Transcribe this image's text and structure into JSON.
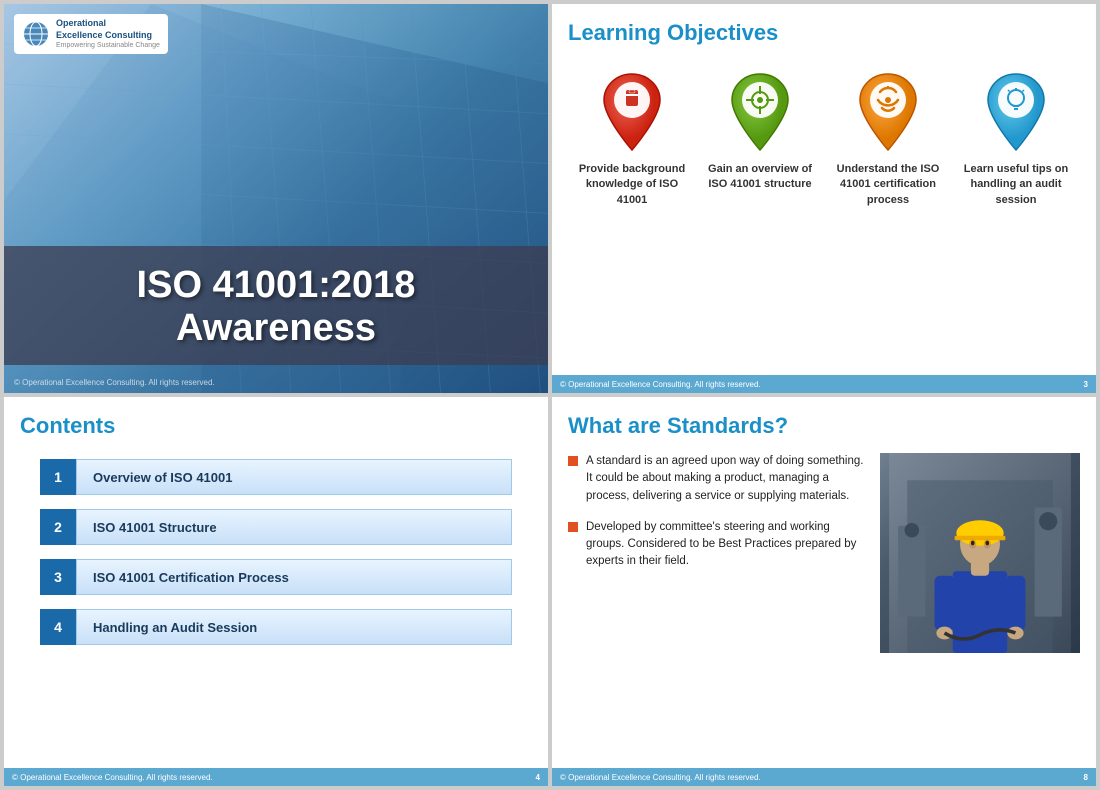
{
  "slide1": {
    "logo_name1": "Operational",
    "logo_name2": "Excellence Consulting",
    "logo_tagline": "Empowering Sustainable Change",
    "title_line1": "ISO 41001:2018",
    "title_line2": "Awareness",
    "copyright": "© Operational Excellence Consulting.  All rights reserved."
  },
  "slide2": {
    "title": "Learning Objectives",
    "objectives": [
      {
        "icon_color": "#d44",
        "inner_color": "#c33",
        "symbol": "📄",
        "text": "Provide background knowledge of ISO 41001"
      },
      {
        "icon_color": "#5a5",
        "inner_color": "#484",
        "symbol": "⬡",
        "text": "Gain an overview of ISO 41001 structure"
      },
      {
        "icon_color": "#e87820",
        "inner_color": "#d06010",
        "symbol": "↻",
        "text": "Understand the ISO 41001 certification process"
      },
      {
        "icon_color": "#38a8d8",
        "inner_color": "#2898c8",
        "symbol": "💡",
        "text": "Learn useful tips on handling an audit session"
      }
    ],
    "footer_text": "© Operational Excellence Consulting.  All rights reserved.",
    "page_num": "3"
  },
  "slide3": {
    "title": "Contents",
    "items": [
      {
        "num": "1",
        "label": "Overview of ISO 41001"
      },
      {
        "num": "2",
        "label": "ISO 41001 Structure"
      },
      {
        "num": "3",
        "label": "ISO 41001 Certification Process"
      },
      {
        "num": "4",
        "label": "Handling an Audit Session"
      }
    ],
    "footer_text": "© Operational Excellence Consulting.  All rights reserved.",
    "page_num": "4"
  },
  "slide4": {
    "title": "What are Standards?",
    "bullets": [
      "A standard is an agreed upon way of doing something. It could be about making a product, managing a process, delivering a service or supplying materials.",
      "Developed by committee's steering and working groups. Considered to be Best Practices prepared by experts in their field."
    ],
    "footer_text": "© Operational Excellence Consulting.  All rights reserved.",
    "page_num": "8"
  }
}
